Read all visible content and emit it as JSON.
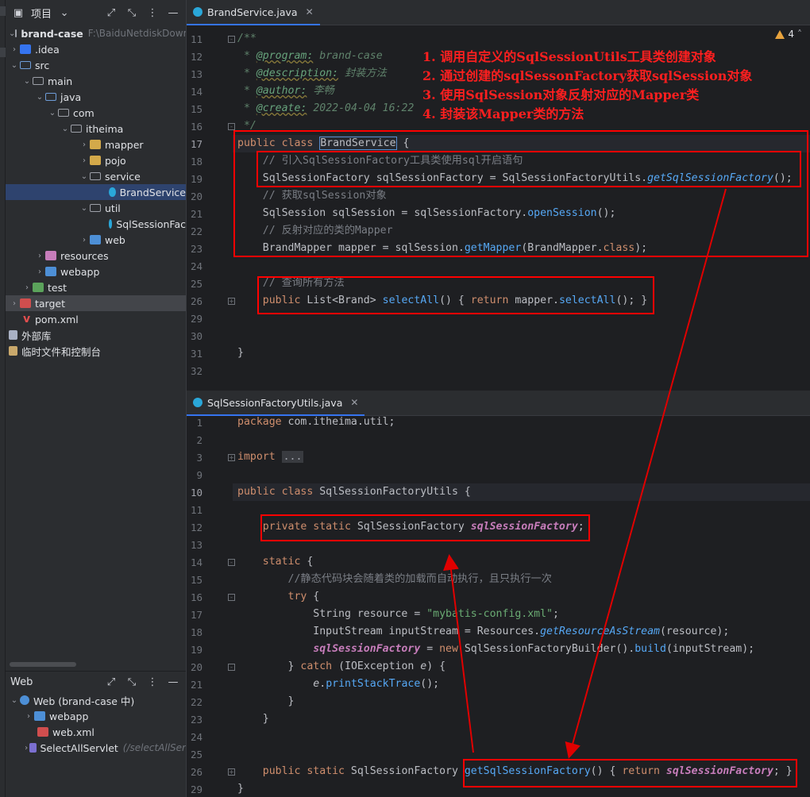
{
  "project_panel": {
    "title": "项目",
    "tree": [
      {
        "label": "brand-case",
        "path": "F:\\BaiduNetdiskDownlo"
      },
      {
        "label": ".idea"
      },
      {
        "label": "src"
      },
      {
        "label": "main"
      },
      {
        "label": "java"
      },
      {
        "label": "com"
      },
      {
        "label": "itheima"
      },
      {
        "label": "mapper"
      },
      {
        "label": "pojo"
      },
      {
        "label": "service"
      },
      {
        "label": "BrandService"
      },
      {
        "label": "util"
      },
      {
        "label": "SqlSessionFac"
      },
      {
        "label": "web"
      },
      {
        "label": "resources"
      },
      {
        "label": "webapp"
      },
      {
        "label": "test"
      },
      {
        "label": "target"
      },
      {
        "label": "pom.xml"
      },
      {
        "label": "外部库"
      },
      {
        "label": "临时文件和控制台"
      }
    ]
  },
  "web_panel": {
    "title": "Web",
    "tree": [
      {
        "label": "Web (brand-case 中)"
      },
      {
        "label": "webapp"
      },
      {
        "label": "web.xml"
      },
      {
        "label": "SelectAllServlet",
        "hint": "(/selectAllSer"
      }
    ]
  },
  "editor_top": {
    "tab": "BrandService.java",
    "warnings": "4",
    "line_numbers": [
      "11",
      "12",
      "13",
      "14",
      "15",
      "16",
      "17",
      "18",
      "19",
      "20",
      "21",
      "22",
      "23",
      "24",
      "25",
      "26",
      "29",
      "30",
      "31",
      "32"
    ],
    "lines": {
      "l11": "/**",
      "l12_tag": "@program:",
      "l12_val": "brand-case",
      "l13_tag": "@description:",
      "l13_val": "封装方法",
      "l14_tag": "@author:",
      "l14_val": "李畅",
      "l15_tag": "@create:",
      "l15_val": "2022-04-04 16:22",
      "l16": " */",
      "l17_kw": "public class",
      "l17_name": "BrandService",
      "l17_end": " {",
      "l18": "// 引入SqlSessionFactory工具类使用sql开启语句",
      "l19_type": "SqlSessionFactory",
      "l19_var": " sqlSessionFactory = ",
      "l19_cls": "SqlSessionFactoryUtils.",
      "l19_fn": "getSqlSessionFactory",
      "l19_end": "();",
      "l20": "// 获取sqlSession对象",
      "l21_a": "SqlSession sqlSession = sqlSessionFactory.",
      "l21_fn": "openSession",
      "l21_end": "();",
      "l22": "// 反射对应的类的Mapper",
      "l23_a": "BrandMapper mapper = sqlSession.",
      "l23_fn": "getMapper",
      "l23_b": "(BrandMapper.",
      "l23_kw": "class",
      "l23_end": ");",
      "l25": "// 查询所有方法",
      "l26_kw": "public",
      "l26_type": " List<Brand> ",
      "l26_fn": "selectAll",
      "l26_b": "() { ",
      "l26_ret": "return",
      "l26_c": " mapper.",
      "l26_fn2": "selectAll",
      "l26_end": "(); }",
      "l31": "}"
    },
    "notes": [
      "1.  调用自定义的SqlSessionUtils工具类创建对象",
      "2.  通过创建的sqlSessonFactory获取sqlSession对象",
      "3.  使用SqlSession对象反射对应的Mapper类",
      "4.  封装该Mapper类的方法"
    ]
  },
  "editor_bottom": {
    "tab": "SqlSessionFactoryUtils.java",
    "line_numbers": [
      "1",
      "2",
      "3",
      "9",
      "10",
      "11",
      "12",
      "13",
      "14",
      "15",
      "16",
      "17",
      "18",
      "19",
      "20",
      "21",
      "22",
      "23",
      "24",
      "25",
      "26",
      "29"
    ],
    "lines": {
      "l1_kw": "package",
      "l1_rest": " com.itheima.util;",
      "l3_kw": "import",
      "l3_fold": "...",
      "l10_kw": "public class",
      "l10_name": " SqlSessionFactoryUtils {",
      "l12_kw": "private static",
      "l12_type": " SqlSessionFactory ",
      "l12_field": "sqlSessionFactory",
      "l12_end": ";",
      "l14_kw": "static",
      "l14_end": " {",
      "l15": "//静态代码块会随着类的加载而自动执行，且只执行一次",
      "l16_kw": "try",
      "l16_end": " {",
      "l17_a": "String resource = ",
      "l17_str": "\"mybatis-config.xml\"",
      "l17_end": ";",
      "l18_a": "InputStream inputStream = Resources.",
      "l18_fn": "getResourceAsStream",
      "l18_end": "(resource);",
      "l19_field": "sqlSessionFactory",
      "l19_a": " = ",
      "l19_kw": "new",
      "l19_b": " SqlSessionFactoryBuilder().",
      "l19_fn": "build",
      "l19_end": "(inputStream);",
      "l20_a": "} ",
      "l20_kw": "catch",
      "l20_b": " (IOException ",
      "l20_param": "e",
      "l20_end": ") {",
      "l21_param": "e",
      "l21_a": ".",
      "l21_fn": "printStackTrace",
      "l21_end": "();",
      "l22": "}",
      "l23": "}",
      "l26_kw": "public static",
      "l26_type": " SqlSessionFactory ",
      "l26_fn": "getSqlSessionFactory",
      "l26_b": "() { ",
      "l26_ret": "return",
      "l26_field": " sqlSessionFactory",
      "l26_end": "; }",
      "l29": "}"
    }
  },
  "colors": {
    "annotation": "#ff0000",
    "selection": "#2e436e",
    "keyword": "#cf8e6d",
    "method": "#56a8f5",
    "string": "#6aab73",
    "field": "#c77dbb",
    "comment": "#7a7e85"
  },
  "icons": [
    "folder-icon",
    "java-class-icon",
    "xml-icon",
    "maven-icon",
    "library-icon",
    "scratch-icon",
    "web-icon",
    "warning-icon",
    "close-icon",
    "chevron-icon",
    "settings-icon",
    "expand-icon",
    "collapse-icon",
    "minimize-icon"
  ]
}
